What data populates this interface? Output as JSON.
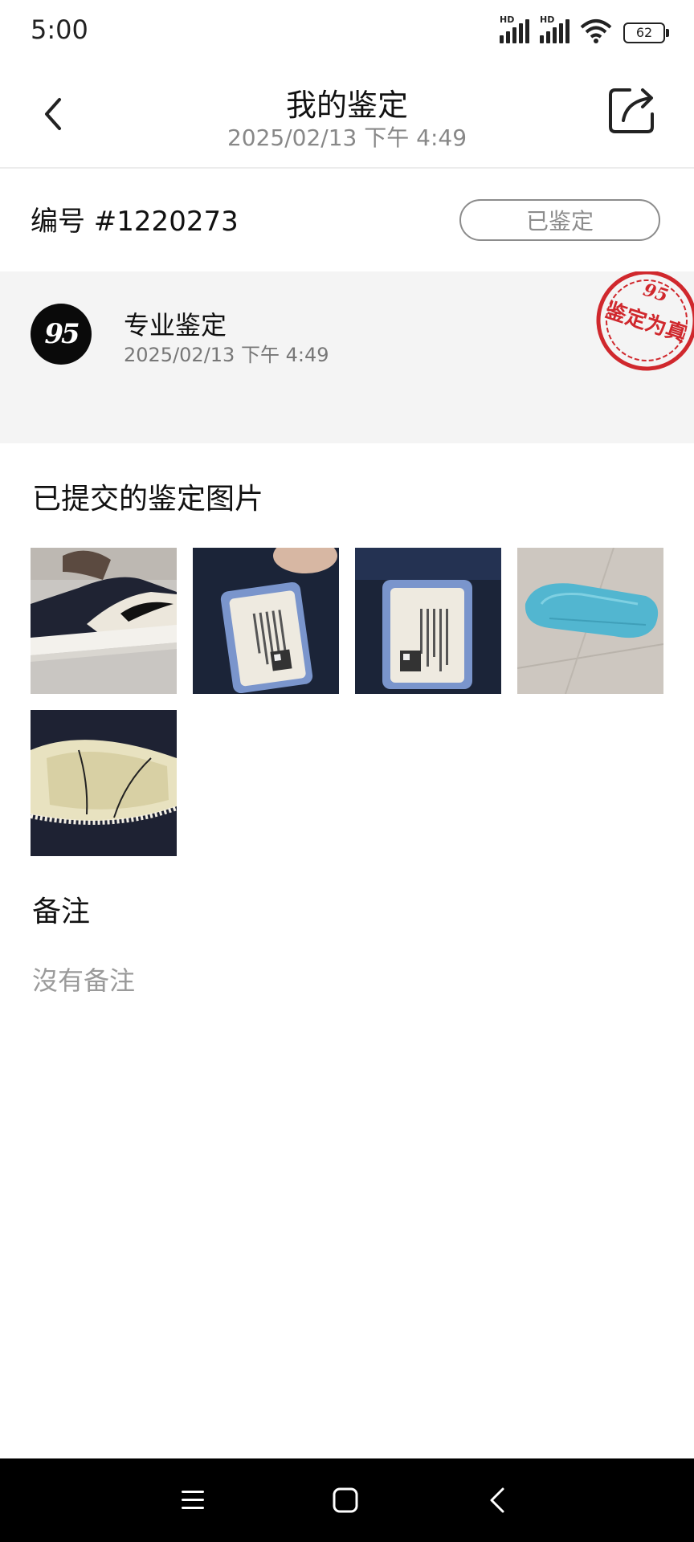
{
  "status_bar": {
    "time": "5:00",
    "signal_labels": [
      "HD",
      "HD"
    ],
    "battery_level": "62",
    "icons": [
      "signal-icon",
      "signal-icon",
      "wifi-icon",
      "battery-icon"
    ]
  },
  "header": {
    "title": "我的鉴定",
    "subtitle": "2025/02/13 下午 4:49",
    "icons": [
      "back-arrow-icon",
      "share-icon"
    ]
  },
  "record": {
    "id_label": "编号 #1220273",
    "status_button": "已鉴定"
  },
  "appraisal_card": {
    "logo_text": "95",
    "title": "专业鉴定",
    "date": "2025/02/13 下午 4:49",
    "stamp_text": "鉴定为真",
    "stamp_brand": "95",
    "stamp_color": "#d0282d"
  },
  "photos": {
    "title": "已提交的鉴定图片",
    "items": [
      {
        "label": "sneaker-side-photo"
      },
      {
        "label": "size-tag-photo-1"
      },
      {
        "label": "size-tag-photo-2"
      },
      {
        "label": "sole-photo"
      },
      {
        "label": "insole-photo"
      }
    ]
  },
  "notes": {
    "title": "备注",
    "empty_text": "沒有备注"
  },
  "nav_bar": {
    "icons": [
      "menu-icon",
      "home-square-icon",
      "back-icon"
    ]
  }
}
